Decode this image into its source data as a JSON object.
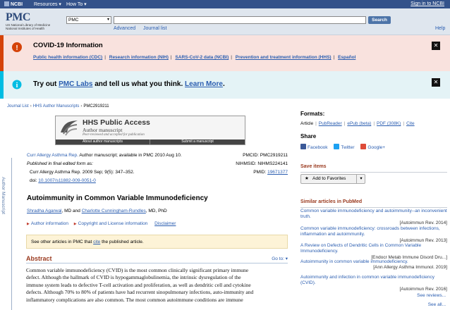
{
  "ncbi_bar": {
    "logo": "NCBI",
    "menu_resources": "Resources",
    "menu_howto": "How To",
    "signin": "Sign in to NCBI"
  },
  "header": {
    "logo": "PMC",
    "nlm_line1": "US National Library of Medicine",
    "nlm_line2": "National Institutes of Health",
    "db_value": "PMC",
    "search_value": "",
    "search_button": "Search",
    "advanced": "Advanced",
    "journal_list": "Journal list",
    "help": "Help"
  },
  "covid": {
    "title": "COVID-19 Information",
    "links": [
      "Public health information (CDC)",
      "Research information (NIH)",
      "SARS-CoV-2 data (NCBI)",
      "Prevention and treatment information (HHS)",
      "Español"
    ],
    "separator": "|",
    "close": "✕"
  },
  "labs": {
    "pre": "Try out ",
    "link": "PMC Labs",
    "mid": " and tell us what you think. ",
    "learn": "Learn More",
    "end": ".",
    "close": "✕"
  },
  "breadcrumb": {
    "items": [
      "Journal List",
      "HHS Author Manuscripts",
      "PMC2919211"
    ],
    "sep": "›"
  },
  "hhs": {
    "title": "HHS Public Access",
    "subtitle": "Author manuscript",
    "peer": "Peer-reviewed and accepted for publication",
    "tab1": "About author manuscripts",
    "tab2": "Submit a manuscript"
  },
  "side_label": "Author Manuscript",
  "citation": {
    "journal": "Curr Allergy Asthma Rep.",
    "line1_rest": " Author manuscript; available in PMC 2010 Aug 10.",
    "line2": "Published in final edited form as:",
    "line3": "Curr Allergy Asthma Rep. 2009 Sep; 9(5): 347–352.",
    "doi_label": "doi: ",
    "doi": "10.1007/s11882-009-0051-0",
    "pmcid": "PMCID: PMC2919211",
    "nihmsid": "NIHMSID: NIHMS224141",
    "pmid_label": "PMID: ",
    "pmid": "19671377"
  },
  "article": {
    "title": "Autoimmunity in Common Variable Immunodeficiency",
    "author1": "Shradha Agarwal",
    "author1_suffix": ", MD and ",
    "author2": "Charlotte Cunningham-Rundles",
    "author2_suffix": ", MD, PhD",
    "author_info": "Author information",
    "copyright": "Copyright and License information",
    "disclaimer": "Disclaimer"
  },
  "notice": {
    "pre": "See other articles in PMC that ",
    "link": "cite",
    "post": " the published article."
  },
  "abstract": {
    "heading": "Abstract",
    "goto": "Go to:",
    "lines": [
      "Common variable immunodeficiency (CVID) is the most common clinically significant primary immune",
      "defect. Although the hallmark of CVID is hypogammaglobulinemia, the intrinsic dysregulation of the",
      "immune system leads to defective T-cell activation and proliferation, as well as dendritic cell and cytokine",
      "defects. Although 70% to 80% of patients have had recurrent sinopulmonary infections, auto-immunity and",
      "inflammatory complications are also common. The most common autoimmune conditions are immune"
    ]
  },
  "formats": {
    "heading": "Formats:",
    "items": [
      "Article",
      "PubReader",
      "ePub (beta)",
      "PDF (308K)",
      "Cite"
    ]
  },
  "share": {
    "heading": "Share",
    "facebook": "Facebook",
    "twitter": "Twitter",
    "google": "Google+"
  },
  "save": {
    "heading": "Save items",
    "button": "Add to Favorites"
  },
  "similar": {
    "heading": "Similar articles in PubMed",
    "items": [
      {
        "title": "Common variable immunodeficiency and autoimmunity--an inconvenient truth.",
        "journal": "[Autoimmun Rev. 2014]"
      },
      {
        "title": "Common variable immunodeficiency: crossroads between infections, inflammation and autoimmunity.",
        "journal": "[Autoimmun Rev. 2013]"
      },
      {
        "title": "A Review on Defects of Dendritic Cells in Common Variable Immunodeficiency.",
        "journal": "[Endocr Metab Immune Disord Dru...]"
      },
      {
        "title": "Autoimmunity in common variable immunodeficiency.",
        "journal": "[Ann Allergy Asthma Immunol. 2019]"
      },
      {
        "title": "Autoimmunity and infection in common variable immunodeficiency (CVID).",
        "journal": "[Autoimmun Rev. 2016]"
      }
    ],
    "see_reviews": "See reviews...",
    "see_all": "See all..."
  },
  "colors": {
    "ncbi_bar": "#33528a",
    "link": "#2a5db0",
    "heading_red": "#9a3a1f"
  }
}
